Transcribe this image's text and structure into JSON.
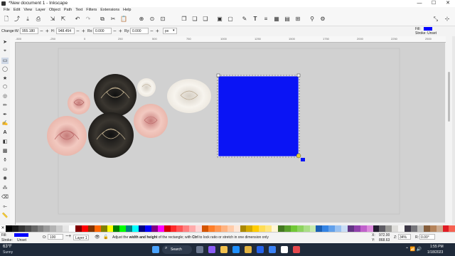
{
  "window": {
    "title": "*New document 1 - Inkscape",
    "min": "—",
    "max": "☐",
    "close": "✕"
  },
  "menu": [
    "File",
    "Edit",
    "View",
    "Layer",
    "Object",
    "Path",
    "Text",
    "Filters",
    "Extensions",
    "Help"
  ],
  "controls": {
    "change_label": "Change:",
    "w_label": "W:",
    "w_value": "955.180",
    "h_label": "H:",
    "h_value": "948.454",
    "rx_label": "Rx:",
    "rx_value": "0.000",
    "ry_label": "Ry:",
    "ry_value": "0.000",
    "unit": "px"
  },
  "fill_stroke_top": {
    "fill_label": "Fill:",
    "stroke_label": "Stroke:",
    "stroke_value": "Unset",
    "fill_color": "#0000ff"
  },
  "colors": {
    "rect_fill": "#0a14f5",
    "canvas_bg": "#d1d1d1"
  },
  "status": {
    "fill_label": "Fill:",
    "stroke_label": "Stroke:",
    "stroke_value": "Unset",
    "opacity_label": "O:",
    "opacity_value": "100",
    "layer": "Layer 1",
    "message_pre": "Adjust the ",
    "message_bold1": "width and height",
    "message_mid": " of the rectangle; with ",
    "message_bold2": "Ctrl",
    "message_post": " to lock ratio or stretch in one dimension only",
    "x_label": "X:",
    "x_value": "972.00",
    "y_label": "Y:",
    "y_value": "868.63",
    "z_label": "Z:",
    "zoom": "34%",
    "r_label": "R:",
    "rotation": "0.00°"
  },
  "ruler_ticks": [
    "-500",
    "-250",
    "0",
    "250",
    "500",
    "750",
    "1000",
    "1250",
    "1500",
    "1750",
    "2000",
    "2250",
    "2500"
  ],
  "palette": [
    "#000000",
    "#1a1a1a",
    "#333333",
    "#4d4d4d",
    "#666666",
    "#808080",
    "#999999",
    "#b3b3b3",
    "#cccccc",
    "#e6e6e6",
    "#ffffff",
    "#800000",
    "#ff0000",
    "#803300",
    "#ff6600",
    "#808000",
    "#ffff00",
    "#008000",
    "#00ff00",
    "#008080",
    "#00ffff",
    "#000080",
    "#0000ff",
    "#800080",
    "#ff00ff",
    "#d40000",
    "#ff2a2a",
    "#ff5555",
    "#ff8080",
    "#ffaaaa",
    "#ffd5d5",
    "#d45500",
    "#ff7f2a",
    "#ff9955",
    "#ffb380",
    "#ffccaa",
    "#ffe6d5",
    "#aa8800",
    "#d4aa00",
    "#ffcc00",
    "#ffdd55",
    "#ffe680",
    "#fff6d5",
    "#447821",
    "#5aa02c",
    "#71c837",
    "#8dd35f",
    "#aade87",
    "#c6e9af",
    "#1a5fb4",
    "#3584e4",
    "#62a0ea",
    "#99c1f1",
    "#c9ddf5",
    "#613583",
    "#9141ac",
    "#c061cb",
    "#dc8add",
    "#241f31",
    "#5e5c64",
    "#9a9996",
    "#deddda",
    "#f6f5f4",
    "#3d3846",
    "#77767b",
    "#c0bfbc",
    "#865e3c",
    "#b5835a",
    "#cdab8f",
    "#e01b24",
    "#f66151"
  ],
  "taskbar": {
    "weather_temp": "63°F",
    "weather_desc": "Sunny",
    "search": "Search",
    "time": "1:55 PM",
    "date": "1/18/2023"
  }
}
